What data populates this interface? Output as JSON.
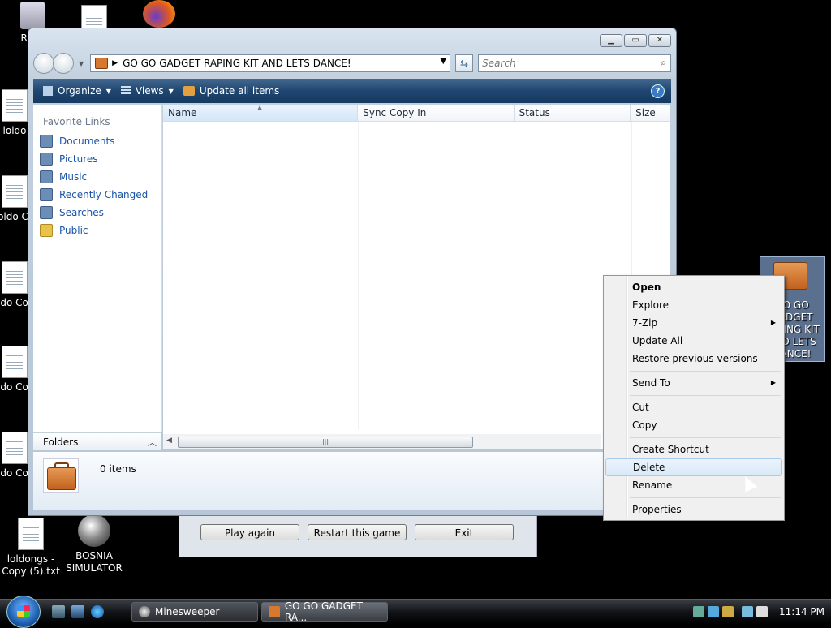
{
  "desktop": {
    "icons": [
      {
        "label": "Recy"
      },
      {
        "label": "loldongs - Copy (5).txt"
      },
      {
        "label": "BOSNIA SIMULATOR"
      }
    ],
    "partial_labels": [
      "loldo",
      "loldo Co",
      "loldo Copy",
      "loldo Copy",
      "loldo Copy"
    ],
    "selected_icon": {
      "label": "GO GO GADGET RAPING KIT AND LETS DANCE!"
    }
  },
  "explorer": {
    "address": "GO GO GADGET RAPING KIT AND LETS DANCE!",
    "search_placeholder": "Search",
    "toolbar": {
      "organize": "Organize",
      "views": "Views",
      "update_all": "Update all items"
    },
    "favorites_title": "Favorite Links",
    "favorites": [
      {
        "label": "Documents",
        "icon": "documents-icon"
      },
      {
        "label": "Pictures",
        "icon": "pictures-icon"
      },
      {
        "label": "Music",
        "icon": "music-icon"
      },
      {
        "label": "Recently Changed",
        "icon": "recently-changed-icon"
      },
      {
        "label": "Searches",
        "icon": "searches-icon"
      },
      {
        "label": "Public",
        "icon": "folder-icon"
      }
    ],
    "folders_label": "Folders",
    "columns": [
      "Name",
      "Sync Copy In",
      "Status",
      "Size"
    ],
    "item_count": "0 items"
  },
  "minesweeper": {
    "play_again": "Play again",
    "restart": "Restart this game",
    "exit": "Exit"
  },
  "context_menu": {
    "items": [
      "Open",
      "Explore",
      "7-Zip",
      "Update All",
      "Restore previous versions",
      "Send To",
      "Cut",
      "Copy",
      "Create Shortcut",
      "Delete",
      "Rename",
      "Properties"
    ],
    "highlighted": "Delete"
  },
  "taskbar": {
    "tasks": [
      "Minesweeper",
      "GO GO GADGET RA..."
    ],
    "clock": "11:14 PM"
  },
  "colors": {
    "accent": "#1f4670",
    "link": "#1a54a6",
    "highlight": "#d9e9f8"
  }
}
